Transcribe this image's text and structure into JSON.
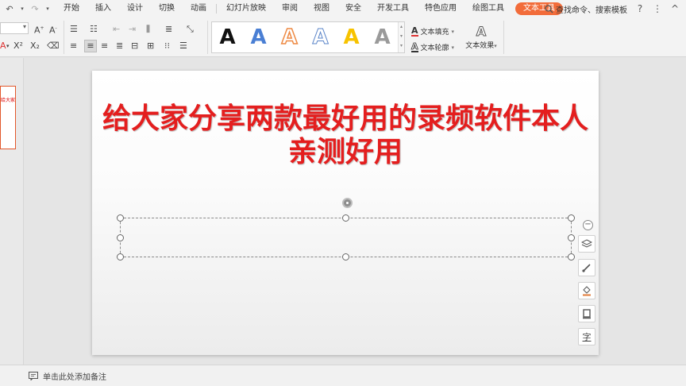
{
  "menubar": {
    "items": [
      "开始",
      "插入",
      "设计",
      "切换",
      "动画",
      "幻灯片放映",
      "审阅",
      "视图",
      "安全",
      "开发工具",
      "特色应用",
      "绘图工具",
      "文本工具"
    ],
    "active_index": 12,
    "search_label": "查找命令、搜索模板",
    "help": "?",
    "more": "⋮",
    "collapse": "^"
  },
  "ribbon": {
    "wordart_letters": [
      "A",
      "A",
      "A",
      "A",
      "A",
      "A"
    ],
    "text_fill_label": "文本填充",
    "text_outline_label": "文本轮廓",
    "text_effect_label": "文本效果"
  },
  "thumbnail": {
    "snippet": "给大家分享两款"
  },
  "slide": {
    "title": "给大家分享两款最好用的录频软件本人亲测好用"
  },
  "notes": {
    "placeholder": "单击此处添加备注"
  },
  "colors": {
    "accent_tab": "#f26c3a",
    "title_red": "#e41e1e"
  }
}
